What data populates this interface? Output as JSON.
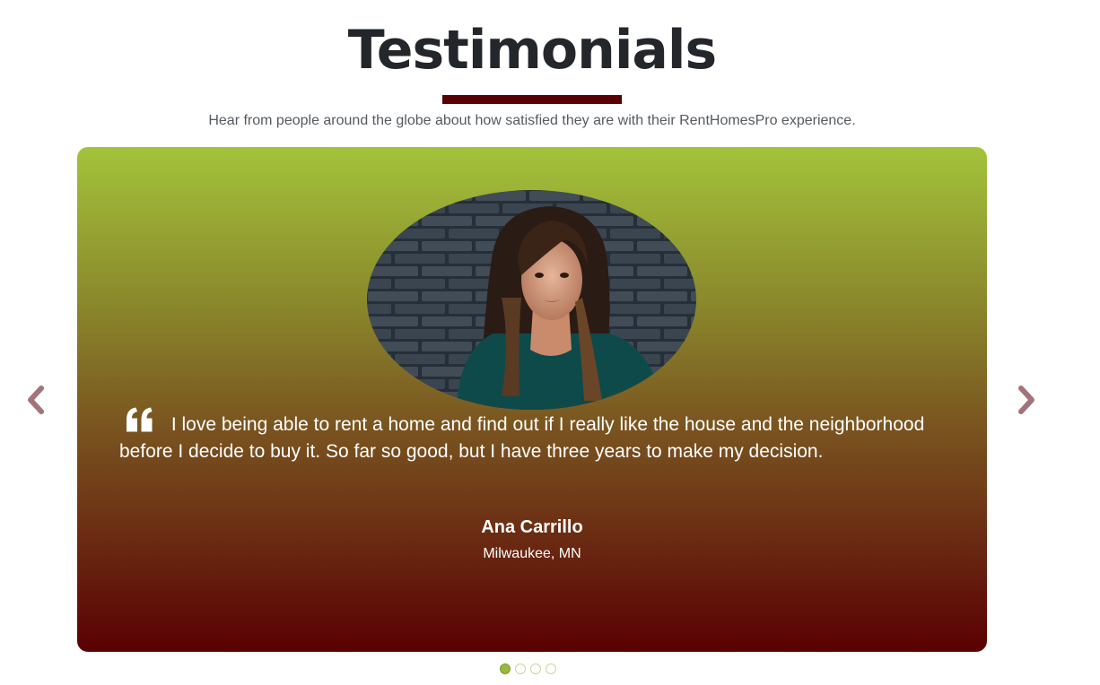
{
  "section": {
    "title": "Testimonials",
    "subtitle": "Hear from people around the globe about how satisfied they are with their RentHomesPro experience."
  },
  "testimonial": {
    "quote": "I love being able to rent a home and find out if I really like the house and the neighborhood before I decide to buy it. So far so good, but I have three years to make my decision.",
    "author": "Ana Carrillo",
    "location": "Milwaukee, MN"
  },
  "carousel": {
    "slide_count": 4,
    "active_index": 0
  },
  "colors": {
    "accent_rule": "#5a0002",
    "gradient_top": "#a3c33b",
    "gradient_bottom": "#5a0003",
    "arrow": "#a27479",
    "dot_active": "#9ab83e"
  },
  "icons": {
    "prev": "chevron-left-icon",
    "next": "chevron-right-icon",
    "quote": "quote-icon"
  }
}
